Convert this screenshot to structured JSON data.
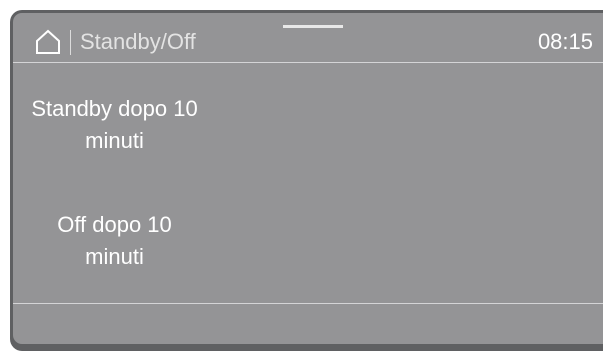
{
  "header": {
    "home_icon": "home-icon",
    "title": "Standby/Off",
    "time": "08:15"
  },
  "options": [
    {
      "label": "Standby dopo 10 minuti"
    },
    {
      "label": "Off dopo 10 minuti"
    }
  ],
  "colors": {
    "screen_background": "#949496",
    "bezel": "#5f6062",
    "text": "#ffffff",
    "divider": "#d4d4d6"
  }
}
